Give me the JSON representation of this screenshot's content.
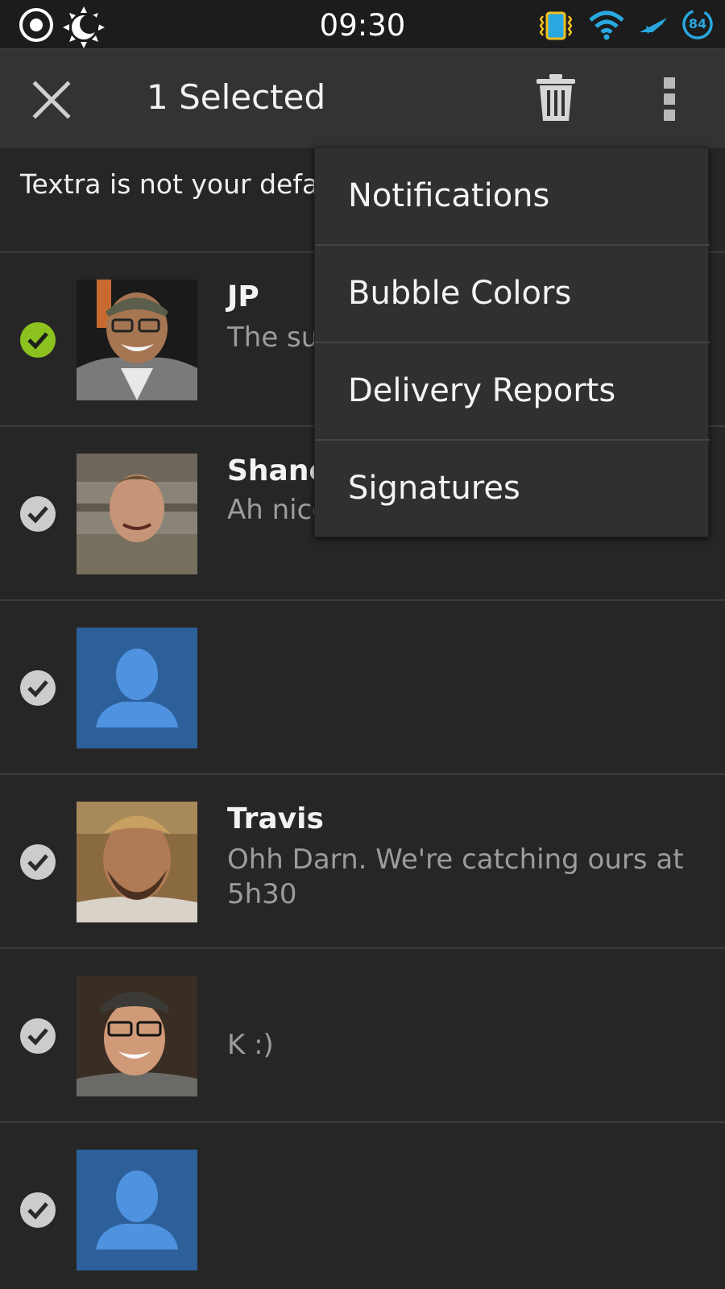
{
  "status_bar": {
    "time": "09:30",
    "battery_level": "84",
    "icons": [
      "camera-icon",
      "brightness-icon",
      "vibrate-icon",
      "wifi-icon",
      "airplane-icon",
      "battery-icon"
    ]
  },
  "action_bar": {
    "close_icon": "close-icon",
    "title": "1 Selected",
    "delete_icon": "trash-icon",
    "overflow_icon": "overflow-menu-icon"
  },
  "banner": {
    "text": "Textra is not your default messaging app."
  },
  "conversations": [
    {
      "name": "JP",
      "snippet": "The super... at poin...",
      "selected": true,
      "avatar": "photo"
    },
    {
      "name": "Shane",
      "snippet": "Ah nice...",
      "selected": false,
      "avatar": "photo"
    },
    {
      "name": "",
      "snippet": "",
      "selected": false,
      "avatar": "default-contact"
    },
    {
      "name": "Travis",
      "snippet": "Ohh Darn. We're catching ours at 5h30",
      "selected": false,
      "avatar": "photo"
    },
    {
      "name": "",
      "snippet": "K :)",
      "selected": false,
      "avatar": "photo"
    },
    {
      "name": "",
      "snippet": "",
      "selected": false,
      "avatar": "default-contact"
    }
  ],
  "menu": {
    "items": [
      "Notifications",
      "Bubble Colors",
      "Delivery Reports",
      "Signatures"
    ]
  },
  "colors": {
    "background": "#262626",
    "action_bar": "#333333",
    "selected_check": "#8cc21f",
    "unselected_check": "#cccccc",
    "default_avatar_bg": "#2d5f9a",
    "default_avatar_fg": "#4f93e0",
    "status_icon_blue": "#29a8e0"
  }
}
